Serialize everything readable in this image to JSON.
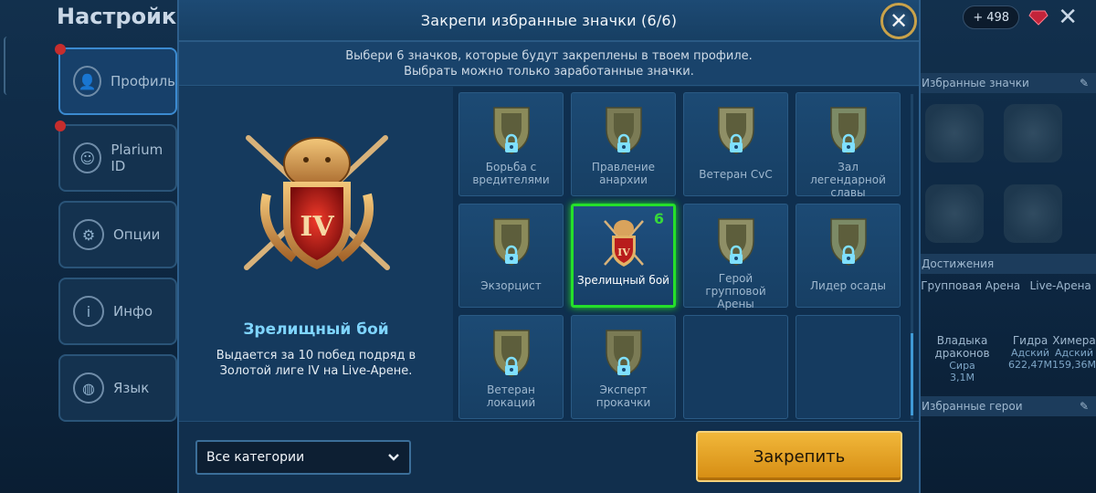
{
  "background": {
    "title": "Настройки",
    "currency_value": "498",
    "menu": [
      {
        "label": "Профиль",
        "icon": "profile-icon",
        "active": true
      },
      {
        "label": "Plarium ID",
        "icon": "plarium-id-icon"
      },
      {
        "label": "Опции",
        "icon": "gear-icon"
      },
      {
        "label": "Инфо",
        "icon": "info-icon"
      },
      {
        "label": "Язык",
        "icon": "globe-icon"
      }
    ],
    "right_panel": {
      "badges_header": "Избранные значки",
      "achievements_header": "Достижения",
      "achievements": [
        {
          "label": "Групповая Арена"
        },
        {
          "label": "Live-Арена"
        }
      ],
      "stats": [
        {
          "label": "Владыка драконов",
          "sub": "Сира",
          "value": "3,1M"
        },
        {
          "label": "Гидра",
          "sub": "Адский",
          "value": "622,47M"
        },
        {
          "label": "Химера",
          "sub": "Адский",
          "value": "159,36M"
        }
      ],
      "heroes_header": "Избранные герои"
    }
  },
  "modal": {
    "title": "Закрепи избранные значки (6/6)",
    "subtitle_line1": "Выбери 6 значков, которые будут закреплены в твоем профиле.",
    "subtitle_line2": "Выбрать можно только заработанные значки.",
    "selected": {
      "name": "Зрелищный бой",
      "description": "Выдается за 10 побед подряд в Золотой лиге IV на Live-Арене.",
      "rank": "IV"
    },
    "badges": [
      {
        "label": "Борьба с вредителями",
        "locked": true
      },
      {
        "label": "Правление анархии",
        "locked": true
      },
      {
        "label": "Ветеран CvC",
        "locked": true
      },
      {
        "label": "Зал легендарной славы",
        "locked": true
      },
      {
        "label": "Экзорцист",
        "locked": true
      },
      {
        "label": "Зрелищный бой",
        "locked": false,
        "selected": true,
        "order": "6"
      },
      {
        "label": "Герой групповой Арены",
        "locked": true
      },
      {
        "label": "Лидер осады",
        "locked": true
      },
      {
        "label": "Ветеран локаций",
        "locked": true
      },
      {
        "label": "Эксперт прокачки",
        "locked": true
      }
    ],
    "category_dropdown": "Все категории",
    "pin_button": "Закрепить"
  },
  "colors": {
    "accent_gold": "#e9a52a",
    "selection_green": "#25e02a",
    "title_cyan": "#7fd5ff",
    "panel_blue": "#14385a"
  }
}
